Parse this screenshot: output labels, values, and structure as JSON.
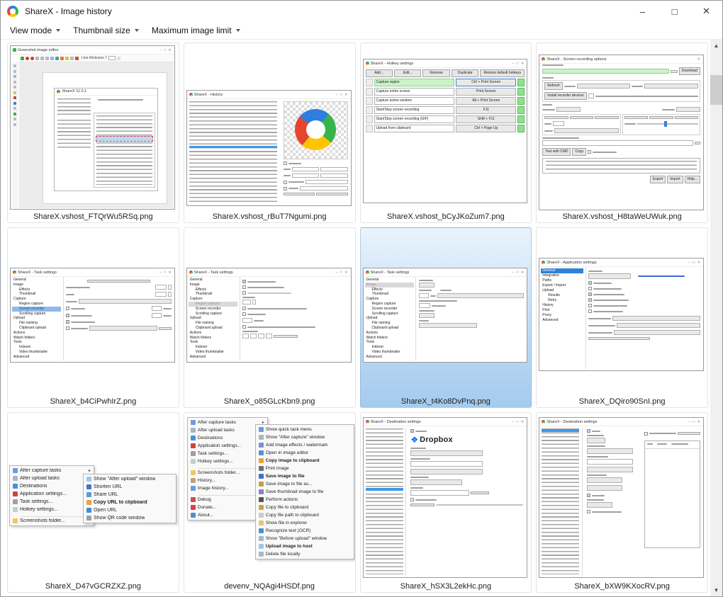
{
  "window": {
    "title": "ShareX - Image history",
    "controls": {
      "minimize": "–",
      "maximize": "□",
      "close": "✕"
    }
  },
  "chrome": {
    "mini_controls": "–  □  ✕",
    "mini_close": "✕",
    "scroll_up": "▲",
    "scroll_down": "▼"
  },
  "menubar": {
    "items": [
      {
        "label": "View mode"
      },
      {
        "label": "Thumbnail size"
      },
      {
        "label": "Maximum image limit"
      }
    ]
  },
  "cells": [
    {
      "filename": "ShareX.vshost_FTQrWu5RSq.png",
      "selected": false
    },
    {
      "filename": "ShareX.vshost_rBuT7Ngumi.png",
      "selected": false
    },
    {
      "filename": "ShareX.vshost_bCyJKoZum7.png",
      "selected": false
    },
    {
      "filename": "ShareX.vshost_H8taWeUWuk.png",
      "selected": false
    },
    {
      "filename": "ShareX_b4CiPwhIrZ.png",
      "selected": false
    },
    {
      "filename": "ShareX_o85GLcKbn9.png",
      "selected": false
    },
    {
      "filename": "ShareX_t4Ko8DvPnq.png",
      "selected": true
    },
    {
      "filename": "ShareX_DQiro90SnI.png",
      "selected": false
    },
    {
      "filename": "ShareX_D47vGCRZXZ.png",
      "selected": false
    },
    {
      "filename": "devenv_NQAgi4HSDf.png",
      "selected": false
    },
    {
      "filename": "ShareX_hSX3L2ekHc.png",
      "selected": false
    },
    {
      "filename": "ShareX_bXW9KXocRV.png",
      "selected": false
    }
  ],
  "editor": {
    "title": "Greenshot image editor",
    "line_thickness": "Line thickness 7",
    "inner_title": "ShareX 11.0.1"
  },
  "history": {
    "title": "ShareX - History"
  },
  "hotkeys": {
    "title": "ShareX - Hotkey settings",
    "buttons": [
      {
        "label": "Add...",
        "flex": "1"
      },
      {
        "label": "Edit...",
        "flex": "1"
      },
      {
        "label": "Remove",
        "flex": "1"
      },
      {
        "label": "Duplicate",
        "flex": "1"
      },
      {
        "label": "Restore default hotkeys",
        "flex": "1.8"
      }
    ],
    "rows": [
      {
        "action": "Capture region",
        "key": "Ctrl + Print Screen",
        "green": true,
        "focus": true
      },
      {
        "action": "Capture entire screen",
        "key": "Print Screen"
      },
      {
        "action": "Capture active window",
        "key": "Alt + Print Screen"
      },
      {
        "action": "Start/Stop screen recording",
        "key": "F11"
      },
      {
        "action": "Start/Stop screen recording (GIF)",
        "key": "Shift + F11"
      },
      {
        "action": "Upload from clipboard",
        "key": "Ctrl + Page Up"
      }
    ]
  },
  "recording": {
    "title": "ShareX - Screen recording options",
    "download": "Download",
    "refresh": "Refresh",
    "install": "Install recorder devices",
    "test_cmd": "Test with CMD",
    "copy": "Copy",
    "export": "Export",
    "import": "Import",
    "help": "Help..."
  },
  "tasks": {
    "title": "ShareX - Task settings"
  },
  "task_tree": {
    "items": [
      {
        "label": "General",
        "pad": "2px"
      },
      {
        "label": "Image",
        "pad": "2px"
      },
      {
        "label": "Effects",
        "pad": "10px"
      },
      {
        "label": "Thumbnail",
        "pad": "10px"
      },
      {
        "label": "Capture",
        "pad": "2px"
      },
      {
        "label": "Region capture",
        "pad": "10px"
      },
      {
        "label": "Screen recorder",
        "pad": "10px"
      },
      {
        "label": "Scrolling capture",
        "pad": "10px"
      },
      {
        "label": "Upload",
        "pad": "2px"
      },
      {
        "label": "File naming",
        "pad": "10px"
      },
      {
        "label": "Clipboard upload",
        "pad": "10px"
      },
      {
        "label": "Actions",
        "pad": "2px"
      },
      {
        "label": "Watch folders",
        "pad": "2px"
      },
      {
        "label": "Tools",
        "pad": "2px"
      },
      {
        "label": "Indexer",
        "pad": "10px"
      },
      {
        "label": "Video thumbnailer",
        "pad": "10px"
      },
      {
        "label": "Advanced",
        "pad": "2px"
      }
    ]
  },
  "appsettings": {
    "title": "ShareX - Application settings",
    "tree": [
      {
        "label": "General",
        "pad": "2px",
        "sel": true
      },
      {
        "label": "Integration",
        "pad": "2px"
      },
      {
        "label": "Paths",
        "pad": "2px"
      },
      {
        "label": "Export / Import",
        "pad": "2px"
      },
      {
        "label": "Upload",
        "pad": "2px"
      },
      {
        "label": "Results",
        "pad": "10px"
      },
      {
        "label": "Retry",
        "pad": "10px"
      },
      {
        "label": "History",
        "pad": "2px"
      },
      {
        "label": "Print",
        "pad": "2px"
      },
      {
        "label": "Proxy",
        "pad": "2px"
      },
      {
        "label": "Advanced",
        "pad": "2px"
      }
    ]
  },
  "menus": {
    "short_left": [
      {
        "label": "After capture tasks",
        "icon": "#6b9ddd",
        "sub": true
      },
      {
        "label": "After upload tasks",
        "icon": "#a8b6c4",
        "sub": true
      },
      {
        "label": "Destinations",
        "icon": "#4a90d9",
        "sub": true
      },
      {
        "label": "Application settings...",
        "icon": "#d04437"
      },
      {
        "label": "Task settings...",
        "icon": "#98a2ab"
      },
      {
        "label": "Hotkey settings...",
        "icon": "#c3ccd3"
      },
      {
        "sep": true
      },
      {
        "label": "Screenshots folder...",
        "icon": "#f3c75f"
      }
    ],
    "short_sub": [
      {
        "label": "Show \"After upload\" window",
        "icon": "#9fc7e8"
      },
      {
        "label": "Shorten URL",
        "icon": "#4a6fd0"
      },
      {
        "label": "Share URL",
        "icon": "#5a9bd5"
      },
      {
        "label": "Copy URL to clipboard",
        "icon": "#e8a33d",
        "bold": true
      },
      {
        "label": "Open URL",
        "icon": "#3f8ed0"
      },
      {
        "label": "Show QR code window",
        "icon": "#9aa0a6"
      }
    ],
    "long_left": [
      {
        "label": "After capture tasks",
        "icon": "#6b9ddd",
        "sub": true
      },
      {
        "label": "After upload tasks",
        "icon": "#a8b6c4",
        "sub": true
      },
      {
        "label": "Destinations",
        "icon": "#4a90d9",
        "sub": true
      },
      {
        "label": "Application settings...",
        "icon": "#d04437"
      },
      {
        "label": "Task settings...",
        "icon": "#98a2ab"
      },
      {
        "label": "Hotkey settings...",
        "icon": "#c3ccd3"
      },
      {
        "sep": true
      },
      {
        "label": "Screenshots folder...",
        "icon": "#f3c75f"
      },
      {
        "label": "History...",
        "icon": "#b9a47e"
      },
      {
        "label": "Image history...",
        "icon": "#6b9ddd"
      },
      {
        "sep": true
      },
      {
        "label": "Debug",
        "icon": "#c75050",
        "sub": true
      },
      {
        "label": "Donate...",
        "icon": "#e03e3e"
      },
      {
        "label": "About...",
        "icon": "#4a90d9"
      }
    ],
    "long_sub": [
      {
        "label": "Show quick task menu",
        "icon": "#6b9ddd"
      },
      {
        "label": "Show \"After capture\" window",
        "icon": "#a8b6c4"
      },
      {
        "label": "Add image effects / watermark",
        "icon": "#7f8fd0"
      },
      {
        "label": "Open in image editor",
        "icon": "#5b8ed6"
      },
      {
        "label": "Copy image to clipboard",
        "icon": "#e8a33d",
        "bold": true
      },
      {
        "label": "Print image",
        "icon": "#6f6f6f"
      },
      {
        "label": "Save image to file",
        "icon": "#3f6fd0",
        "bold": true
      },
      {
        "label": "Save image to file as...",
        "icon": "#c9a23d"
      },
      {
        "label": "Save thumbnail image to file",
        "icon": "#8a7fd0"
      },
      {
        "label": "Perform actions",
        "icon": "#555555"
      },
      {
        "label": "Copy file to clipboard",
        "icon": "#d0a23d"
      },
      {
        "label": "Copy file path to clipboard",
        "icon": "#c3ccd3"
      },
      {
        "label": "Show file in explorer",
        "icon": "#e5c76a"
      },
      {
        "label": "Recognize text (OCR)",
        "icon": "#4a90d9"
      },
      {
        "label": "Show \"Before upload\" window",
        "icon": "#a8b6c4"
      },
      {
        "label": "Upload image to host",
        "icon": "#9fc7e8",
        "bold": true
      },
      {
        "label": "Delete file locally",
        "icon": "#b0b8bf"
      }
    ]
  },
  "destinations": {
    "title": "ShareX - Destination settings",
    "dropbox_brand": "Dropbox",
    "dropbox_glyph": "❖"
  }
}
